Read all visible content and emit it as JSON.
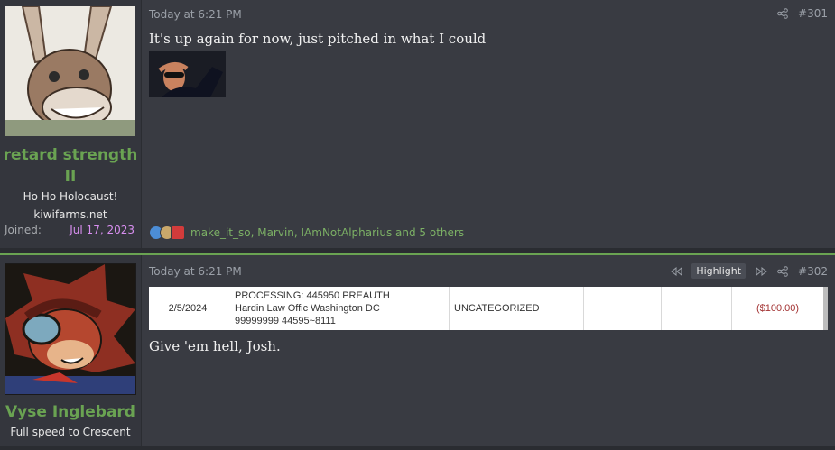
{
  "posts": [
    {
      "username": "retard strength II",
      "user_title": "Ho Ho Holocaust!",
      "user_site": "kiwifarms.net",
      "joined_label": "Joined:",
      "joined_date": "Jul 17, 2023",
      "timestamp": "Today at 6:21 PM",
      "post_number": "#301",
      "body": "It's up again for now, just pitched in what I could",
      "reactions_text": "make_it_so, Marvin, IAmNotAlpharius and 5 others"
    },
    {
      "username": "Vyse Inglebard",
      "user_title": "Full speed to Crescent",
      "timestamp": "Today at 6:21 PM",
      "highlight_label": "Highlight",
      "post_number": "#302",
      "transaction": {
        "date": "2/5/2024",
        "description": [
          "PROCESSING: 445950 PREAUTH",
          "Hardin Law Offic Washington DC",
          "99999999 44595~8111"
        ],
        "category": "UNCATEGORIZED",
        "amount": "($100.00)"
      },
      "body": "Give 'em hell, Josh."
    }
  ],
  "colors": {
    "username": "#6aa352",
    "joined": "#d88ff0",
    "amount": "#a33333"
  },
  "icons": [
    "share-icon",
    "rewind-icon",
    "fast-forward-icon",
    "like-reaction-icon",
    "award-reaction-icon",
    "heart-reaction-icon"
  ]
}
